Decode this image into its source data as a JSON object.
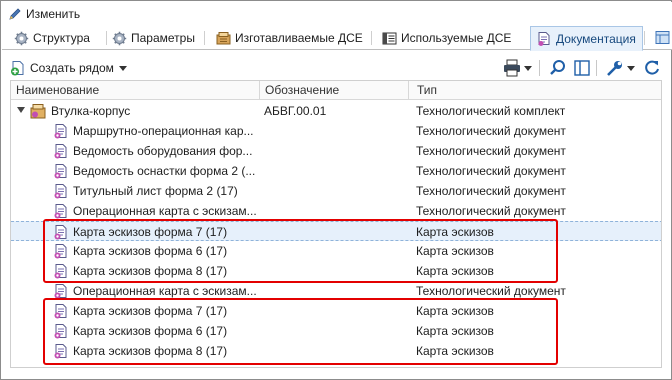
{
  "title": "Изменить",
  "tabs": [
    {
      "label": "Структура",
      "icon": "gear-icon",
      "active": false
    },
    {
      "label": "Параметры",
      "icon": "gear-icon",
      "active": false
    },
    {
      "label": "Изготавливаемые ДСЕ",
      "icon": "parts-made-icon",
      "active": false
    },
    {
      "label": "Используемые ДСЕ",
      "icon": "parts-used-icon",
      "active": false
    },
    {
      "label": "Документация",
      "icon": "documents-icon",
      "active": true
    }
  ],
  "toolbar": {
    "create_label": "Создать рядом"
  },
  "grid": {
    "columns": [
      "Наименование",
      "Обозначение",
      "Тип"
    ],
    "root": {
      "name": "Втулка-корпус",
      "designation": "АБВГ.00.01",
      "type": "Технологический комплект"
    },
    "rows": [
      {
        "name": "Маршрутно-операционная кар...",
        "type": "Технологический документ"
      },
      {
        "name": "Ведомость оборудования фор...",
        "type": "Технологический документ"
      },
      {
        "name": "Ведомость оснастки форма 2 (...",
        "type": "Технологический документ"
      },
      {
        "name": "Титульный лист форма 2 (17)",
        "type": "Технологический документ"
      },
      {
        "name": "Операционная карта с эскизам...",
        "type": "Технологический документ"
      },
      {
        "name": "Карта эскизов форма 7 (17)",
        "type": "Карта эскизов"
      },
      {
        "name": "Карта эскизов форма 6 (17)",
        "type": "Карта эскизов"
      },
      {
        "name": "Карта эскизов форма 8 (17)",
        "type": "Карта эскизов"
      },
      {
        "name": "Операционная карта с эскизам...",
        "type": "Технологический документ"
      },
      {
        "name": "Карта эскизов форма 7 (17)",
        "type": "Карта эскизов"
      },
      {
        "name": "Карта эскизов форма 6 (17)",
        "type": "Карта эскизов"
      },
      {
        "name": "Карта эскизов форма 8 (17)",
        "type": "Карта эскизов"
      }
    ]
  },
  "colors": {
    "highlight": "#e30000",
    "selection": "#e6f0fb",
    "active_tab": "#e8f1fb"
  }
}
